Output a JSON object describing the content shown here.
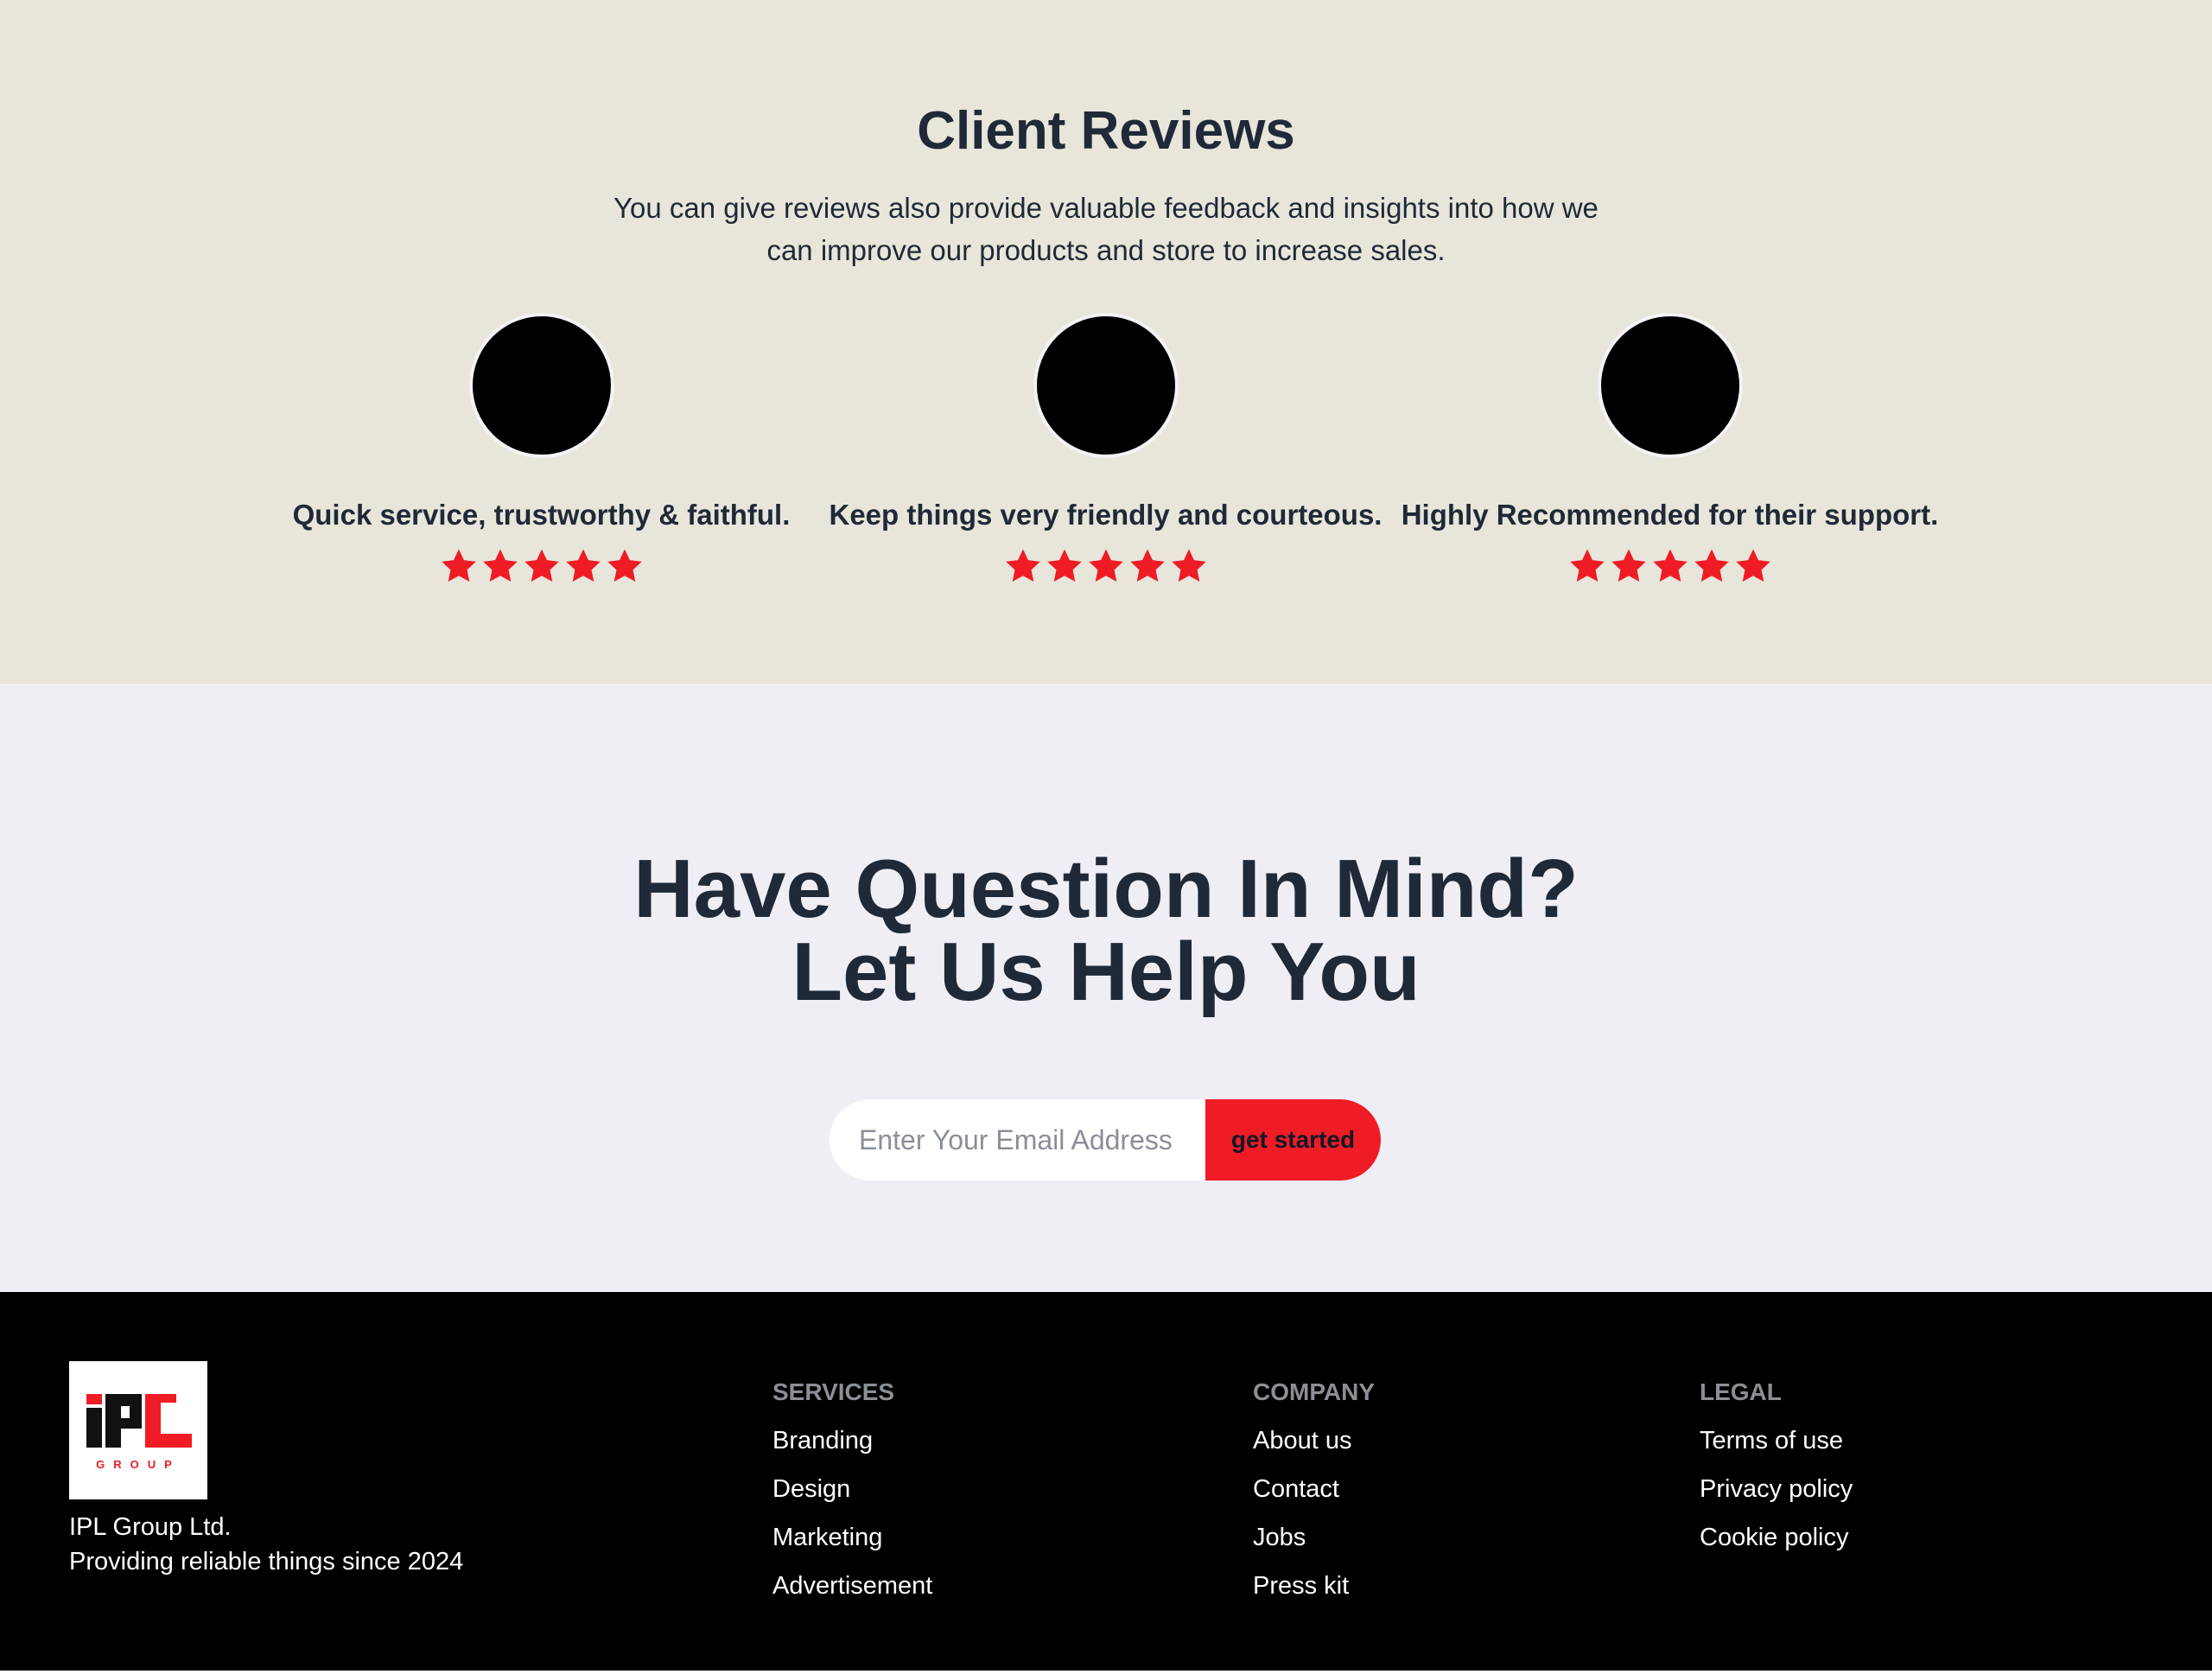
{
  "reviews": {
    "title": "Client Reviews",
    "subtitle": "You can give reviews also provide valuable feedback and insights into how we can improve our products and store to increase sales.",
    "star_color": "#ef1c25",
    "items": [
      {
        "text": "Quick service, trustworthy & faithful.",
        "rating": 5
      },
      {
        "text": "Keep things very friendly and courteous.",
        "rating": 5
      },
      {
        "text": "Highly Recommended for their support.",
        "rating": 5
      }
    ]
  },
  "help": {
    "title_line1": "Have Question In Mind?",
    "title_line2": "Let Us Help You",
    "email_placeholder": "Enter Your Email Address",
    "button_label": "get started",
    "accent_color": "#ef1c25"
  },
  "footer": {
    "logo_text": "IPL",
    "logo_subtext": "GROUP",
    "company_name": "IPL Group Ltd.",
    "company_tagline": "Providing reliable things since 2024",
    "columns": [
      {
        "heading": "SERVICES",
        "links": [
          "Branding",
          "Design",
          "Marketing",
          "Advertisement"
        ]
      },
      {
        "heading": "COMPANY",
        "links": [
          "About us",
          "Contact",
          "Jobs",
          "Press kit"
        ]
      },
      {
        "heading": "LEGAL",
        "links": [
          "Terms of use",
          "Privacy policy",
          "Cookie policy"
        ]
      }
    ]
  }
}
